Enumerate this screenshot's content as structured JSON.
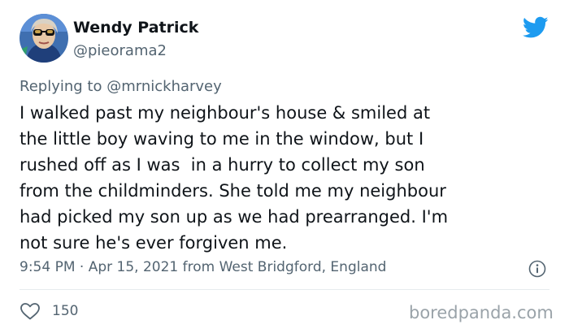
{
  "tweet": {
    "display_name": "Wendy Patrick",
    "handle": "@pieorama2",
    "replying_prefix": "Replying to",
    "replying_handle": "@mrnickharvey",
    "text_lines": [
      "I walked past my neighbour's house & smiled at",
      "the little boy waving to me in the window, but I",
      "rushed off as I was  in a hurry to collect my son",
      "from the childminders. She told me my neighbour",
      "had picked my son up as we had prearranged. I'm",
      "not sure he's ever forgiven me."
    ],
    "meta": "9:54 PM · Apr 15, 2021 from West Bridgford, England",
    "likes": "150"
  },
  "watermark": "boredpanda.com",
  "icons": {
    "bird": "twitter-bird-icon",
    "info": "info-icon",
    "heart": "heart-icon"
  },
  "colors": {
    "twitter_blue": "#1d9bf0",
    "secondary_text": "#536471",
    "primary_text": "#0f1419"
  }
}
